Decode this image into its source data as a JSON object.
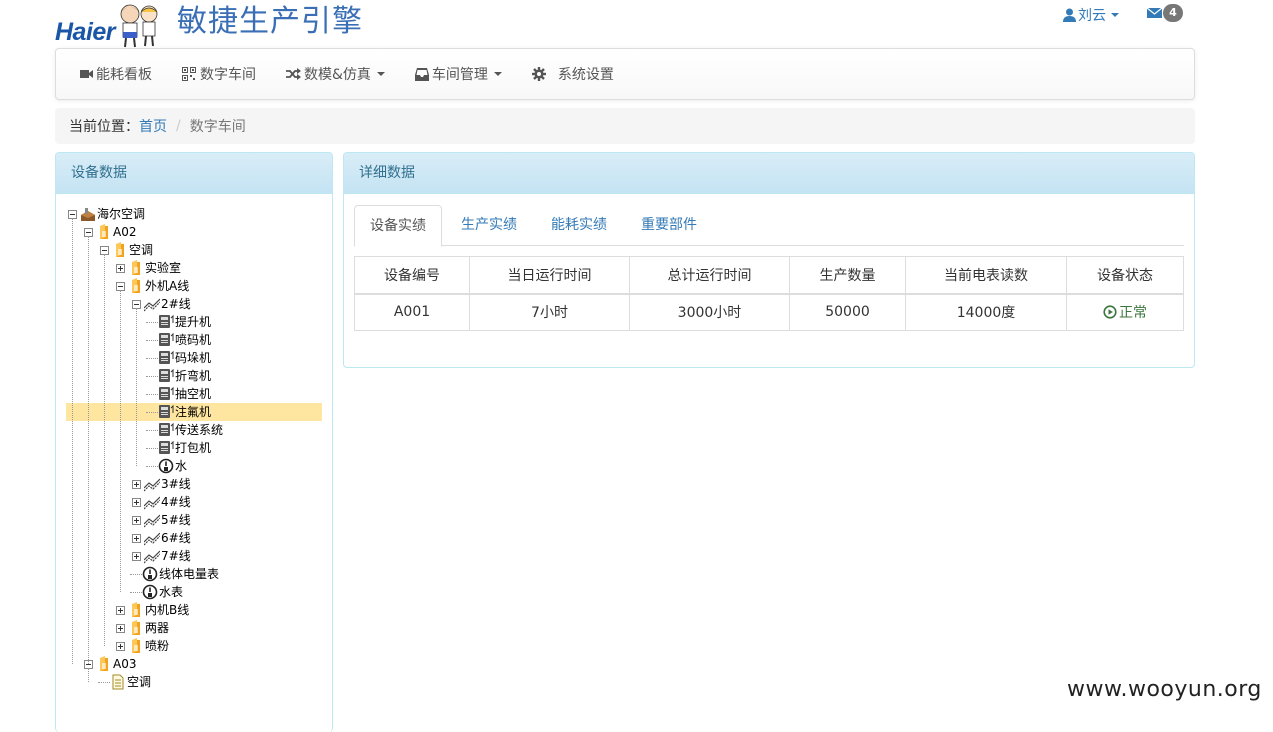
{
  "brand": {
    "logo_text": "Haier",
    "app_title": "敏捷生产引擎"
  },
  "user": {
    "name": "刘云",
    "mail_count": "4"
  },
  "navbar": {
    "items": [
      {
        "label": "能耗看板",
        "icon": "video-icon"
      },
      {
        "label": "数字车间",
        "icon": "qrcode-icon"
      },
      {
        "label": "数模&仿真",
        "icon": "random-icon",
        "dropdown": true
      },
      {
        "label": "车间管理",
        "icon": "inbox-icon",
        "dropdown": true
      },
      {
        "label": "系统设置",
        "icon": "gear-icon"
      }
    ]
  },
  "breadcrumb": {
    "prefix": "当前位置：",
    "home": "首页",
    "current": "数字车间"
  },
  "left_panel": {
    "title": "设备数据"
  },
  "tree": [
    {
      "label": "海尔空调",
      "icon": "factory",
      "expander": "minus"
    },
    {
      "label": "A02",
      "icon": "folder",
      "expander": "minus"
    },
    {
      "label": "空调",
      "icon": "folder",
      "expander": "minus"
    },
    {
      "label": "实验室",
      "icon": "folder",
      "expander": "plus"
    },
    {
      "label": "外机A线",
      "icon": "folder",
      "expander": "minus"
    },
    {
      "label": "2#线",
      "icon": "line",
      "expander": "minus"
    },
    {
      "label": "提升机",
      "icon": "machine"
    },
    {
      "label": "喷码机",
      "icon": "machine"
    },
    {
      "label": "码垛机",
      "icon": "machine"
    },
    {
      "label": "折弯机",
      "icon": "machine"
    },
    {
      "label": "抽空机",
      "icon": "machine"
    },
    {
      "label": "注氟机",
      "icon": "machine",
      "selected": true
    },
    {
      "label": "传送系统",
      "icon": "machine"
    },
    {
      "label": "打包机",
      "icon": "machine"
    },
    {
      "label": "水",
      "icon": "meter"
    },
    {
      "label": "3#线",
      "icon": "line",
      "expander": "plus"
    },
    {
      "label": "4#线",
      "icon": "line",
      "expander": "plus"
    },
    {
      "label": "5#线",
      "icon": "line",
      "expander": "plus"
    },
    {
      "label": "6#线",
      "icon": "line",
      "expander": "plus"
    },
    {
      "label": "7#线",
      "icon": "line",
      "expander": "plus"
    },
    {
      "label": "线体电量表",
      "icon": "meter"
    },
    {
      "label": "水表",
      "icon": "meter"
    },
    {
      "label": "内机B线",
      "icon": "folder",
      "expander": "plus"
    },
    {
      "label": "两器",
      "icon": "folder",
      "expander": "plus"
    },
    {
      "label": "喷粉",
      "icon": "folder",
      "expander": "plus"
    },
    {
      "label": "A03",
      "icon": "folder",
      "expander": "minus"
    },
    {
      "label": "空调",
      "icon": "doc"
    }
  ],
  "right_panel": {
    "title": "详细数据"
  },
  "tabs": [
    "设备实绩",
    "生产实绩",
    "能耗实绩",
    "重要部件"
  ],
  "table": {
    "headers": [
      "设备编号",
      "当日运行时间",
      "总计运行时间",
      "生产数量",
      "当前电表读数",
      "设备状态"
    ],
    "rows": [
      {
        "id": "A001",
        "today": "7小时",
        "total": "3000小时",
        "qty": "50000",
        "meter": "14000度",
        "status": "正常"
      }
    ]
  },
  "watermark": "www.wooyun.org",
  "colors": {
    "link": "#337ab7",
    "status_ok": "#3c763d",
    "panel_heading": "#d9edf7",
    "selected_row": "#ffe6a0"
  }
}
